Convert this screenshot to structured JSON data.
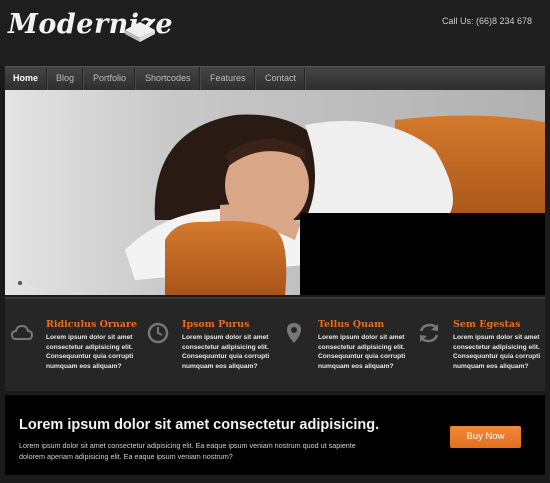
{
  "header": {
    "logo_text": "Modernize",
    "call": "Call Us: (66)8 234 678"
  },
  "nav": {
    "items": [
      {
        "label": "Home",
        "active": true
      },
      {
        "label": "Blog"
      },
      {
        "label": "Portfolio"
      },
      {
        "label": "Shortcodes"
      },
      {
        "label": "Features"
      },
      {
        "label": "Contact"
      }
    ]
  },
  "slider": {
    "slide_count": 4,
    "active_slide": 1
  },
  "features": [
    {
      "icon": "cloud-icon",
      "title": "Ridiculus Ornare",
      "text": "Lorem ipsum dolor sit amet consectetur adipisicing elit. Consequuntur quia corrupti numquam eos aliquam?"
    },
    {
      "icon": "clock-icon",
      "title": "Ipsom Purus",
      "text": "Lorem ipsum dolor sit amet consectetur adipisicing elit. Consequuntur quia corrupti numquam eos aliquam?"
    },
    {
      "icon": "map-pin-icon",
      "title": "Tellus Quam",
      "text": "Lorem ipsum dolor sit amet consectetur adipisicing elit. Consequuntur quia corrupti numquam eos aliquam?"
    },
    {
      "icon": "refresh-icon",
      "title": "Sem Egestas",
      "text": "Lorem ipsum dolor sit amet consectetur adipisicing elit. Consequuntur quia corrupti numquam eos aliquam?"
    }
  ],
  "cta": {
    "title": "Lorem ipsum dolor sit amet consectetur adipisicing.",
    "text": "Lorem ipsum dolor sit amet consectetur adipisicing elit. Ea eaque ipsum veniam nostrum quod ut sapiente dolorem aperiam adipisicing elit. Ea eaque ipsum veniam nostrum?",
    "button_label": "Buy Now"
  },
  "colors": {
    "accent": "#e86d22",
    "background": "#1b1b1b",
    "nav": "#3a3a3a"
  }
}
